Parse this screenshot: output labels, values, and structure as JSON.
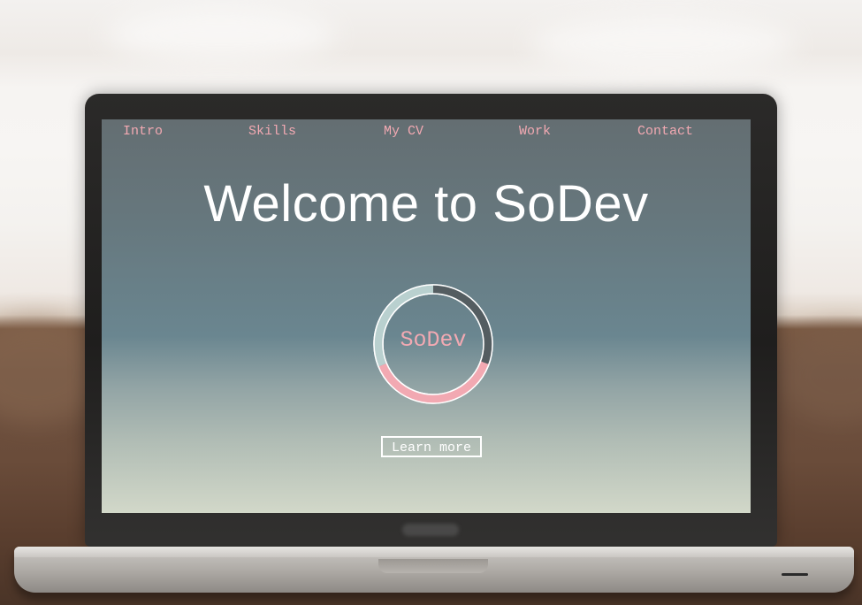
{
  "nav": {
    "items": [
      {
        "label": "Intro"
      },
      {
        "label": "Skills"
      },
      {
        "label": "My CV"
      },
      {
        "label": "Work"
      },
      {
        "label": "Contact"
      }
    ]
  },
  "hero": {
    "title": "Welcome to SoDev",
    "logo_text": "SoDev",
    "cta_label": "Learn more"
  },
  "colors": {
    "accent_pink": "#f2a9b2",
    "ring_light": "#b9d0cf",
    "ring_dark": "#545d61",
    "text_white": "#ffffff"
  }
}
